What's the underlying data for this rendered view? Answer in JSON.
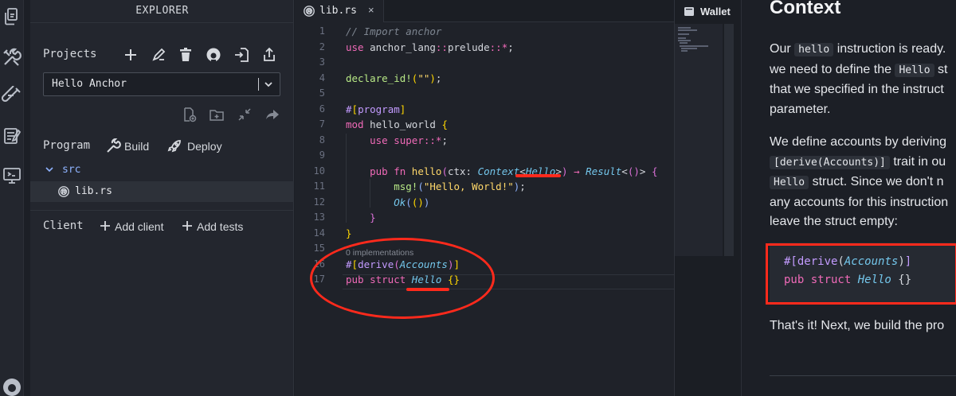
{
  "activity_bar": {
    "icons": [
      "files-icon",
      "tools-icon",
      "test-tube-icon",
      "notes-icon",
      "monitor-icon",
      "github-icon"
    ]
  },
  "explorer": {
    "title": "EXPLORER",
    "projects_label": "Projects",
    "project_select": {
      "value": "Hello Anchor"
    },
    "program_label": "Program",
    "build_label": "Build",
    "deploy_label": "Deploy",
    "folder": "src",
    "file": "lib.rs",
    "client_label": "Client",
    "add_client_label": "Add client",
    "add_tests_label": "Add tests"
  },
  "editor": {
    "tab": {
      "label": "lib.rs",
      "close": "×"
    },
    "implementations_hint": "0 implementations",
    "line_numbers": [
      "1",
      "2",
      "3",
      "4",
      "5",
      "6",
      "7",
      "8",
      "9",
      "10",
      "11",
      "12",
      "13",
      "14",
      "15",
      "16",
      "17"
    ]
  },
  "wallet": {
    "label": "Wallet"
  },
  "docs": {
    "title": "Context",
    "p1": {
      "l1_a": "Our ",
      "l1_code": "hello",
      "l1_b": " instruction is ready.",
      "l2_a": "we need to define the ",
      "l2_code": "Hello",
      "l2_b": " st",
      "l3": "that we specified in the instruct",
      "l4": "parameter."
    },
    "p2": {
      "l1": "We define accounts by deriving",
      "l2_code": "[derive(Accounts)]",
      "l2_b": " trait in ou",
      "l3_code": "Hello",
      "l3_b": " struct. Since we don't n",
      "l4": "any accounts for this instruction",
      "l5": "leave the struct empty:"
    },
    "snippet": {
      "l1_hash": "#[",
      "l1_derive": "derive",
      "l1_paren1": "(",
      "l1_accounts": "Accounts",
      "l1_paren2": ")",
      "l1_close": "]",
      "l2_kw": "pub struct ",
      "l2_name": "Hello",
      "l2_rest": " {}"
    },
    "p3": "That's it! Next, we build the pro"
  },
  "colors": {
    "annotation": "#ff2a1c",
    "keyword": "#f06ab8",
    "type": "#74c7ec"
  }
}
